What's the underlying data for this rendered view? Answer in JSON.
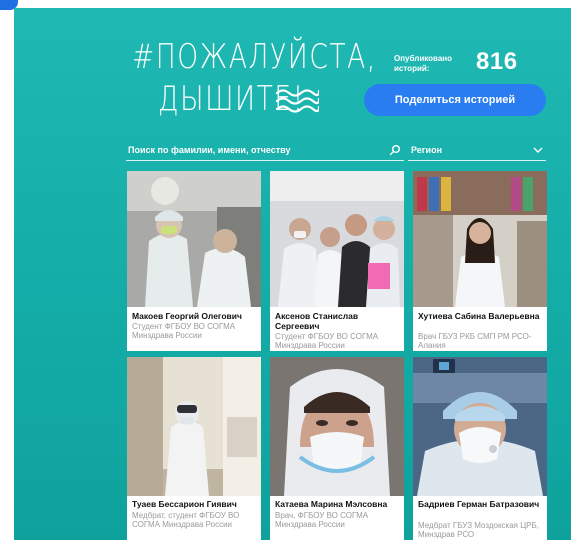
{
  "brand": {
    "logo_line1": "#ПОЖАЛУЙСТА,",
    "logo_line2": "ДЫШИТЕ!"
  },
  "stats": {
    "label": "Опубликовано историй:",
    "count": "816"
  },
  "share_button_label": "Поделиться историей",
  "search": {
    "placeholder": "Поиск по фамилии, имени, отчеству"
  },
  "region_filter": {
    "label": "Регион"
  },
  "colors": {
    "background": "#14aca7",
    "button": "#2a7df0",
    "card": "#ffffff"
  },
  "stories": [
    {
      "name": "Макоев Георгий Олегович",
      "description": "Студент ФГБОУ ВО СОГМА Минздрава России"
    },
    {
      "name": "Аксенов Станислав Сергеевич",
      "description": "Студент ФГБОУ ВО СОГМА Минздрава России"
    },
    {
      "name": "Хутиева Сабина Валерьевна",
      "description": "Врач ГБУЗ РКБ СМП РМ РСО-Алания"
    },
    {
      "name": "Туаев Бессарион Гиявич",
      "description": "Медбрат, студент ФГБОУ ВО СОГМА Минздрава России"
    },
    {
      "name": "Катаева Марина Мэлсовна",
      "description": "Врач, ФГБОУ ВО СОГМА Минздрава России"
    },
    {
      "name": "Бадриев Герман Батразович",
      "description": "Медбрат ГБУЗ Моздокская ЦРБ, Минздрав РСО"
    }
  ]
}
